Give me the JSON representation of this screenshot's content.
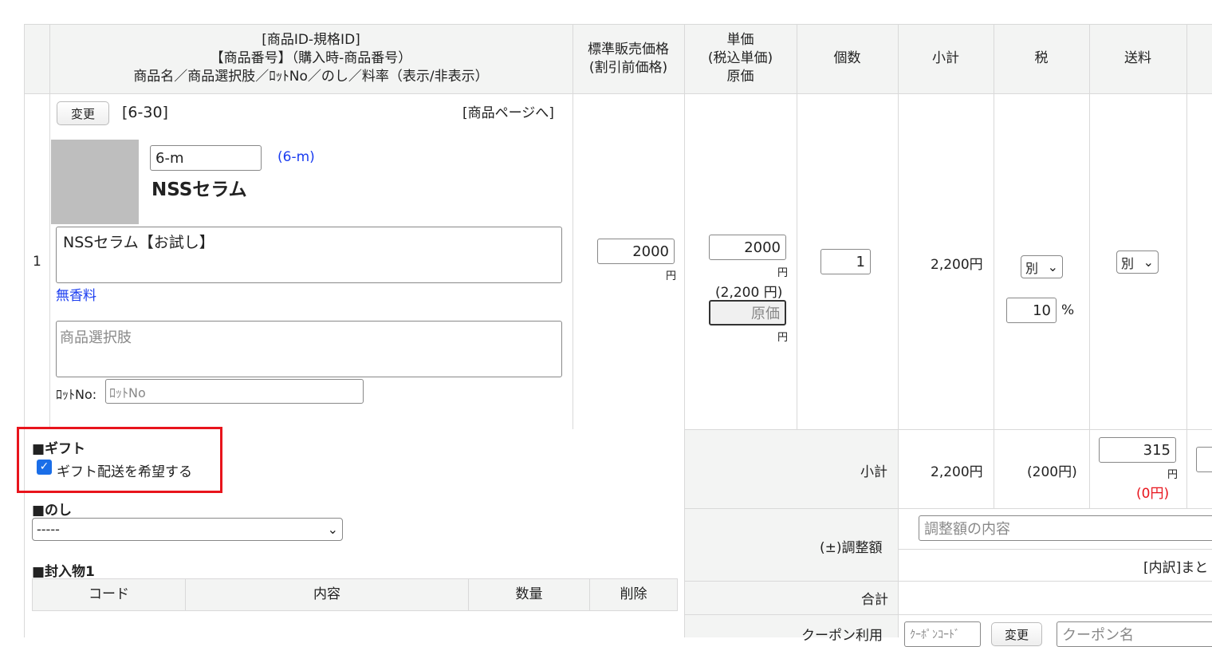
{
  "header": {
    "product_col": [
      "[商品ID-規格ID]",
      "【商品番号】（購入時-商品番号）",
      "商品名／商品選択肢／ﾛｯﾄNo／のし／料率（表示/非表示）"
    ],
    "std_price": [
      "標準販売価格",
      "(割引前価格)"
    ],
    "unit_price": [
      "単価",
      "(税込単価)",
      "原価"
    ],
    "qty": "個数",
    "subtotal": "小計",
    "tax": "税",
    "shipping": "送料"
  },
  "row": {
    "index": "1",
    "change_button": "変更",
    "id": "[6-30]",
    "product_page_link": "[商品ページへ]",
    "product_number": "6-m",
    "purchase_number": "(6-m)",
    "product_name": "NSSセラム",
    "name_textarea": "NSSセラム【お試し】",
    "option_link": "無香料",
    "option_placeholder": "商品選択肢",
    "lot_label": "ﾛｯﾄNo:",
    "lot_placeholder": "ﾛｯﾄNo",
    "std_price": "2000",
    "yen": "円",
    "unit_price": "2000",
    "tax_incl": "(2,200 円)",
    "cost_placeholder": "原価",
    "qty": "1",
    "subtotal": "2,200円",
    "tax_select": "別",
    "tax_rate": "10",
    "percent": "%",
    "ship_select": "別"
  },
  "gift": {
    "heading": "■ギフト",
    "checkbox_label": "ギフト配送を希望する",
    "checked": true
  },
  "noshi": {
    "heading": "■のし",
    "value": "-----"
  },
  "enclosure": {
    "heading": "■封入物1",
    "columns": [
      "コード",
      "内容",
      "数量",
      "削除"
    ]
  },
  "summary": {
    "subtotal_label": "小計",
    "subtotal": "2,200円",
    "tax": "(200円)",
    "shipping": "315",
    "yen": "円",
    "shipping_note": "(0円)",
    "adjust_label": "(±)調整額",
    "adjust_placeholder": "調整額の内容",
    "breakdown": "[内訳]まと",
    "total_label": "合計",
    "coupon_label": "クーポン利用",
    "coupon_code_placeholder": "ｸｰﾎﾟﾝｺｰﾄﾞ",
    "coupon_change": "変更",
    "coupon_name_placeholder": "クーポン名"
  },
  "colors": {
    "highlight": "#e8141c",
    "link": "#1a3cf0",
    "note": "#e8141c"
  }
}
